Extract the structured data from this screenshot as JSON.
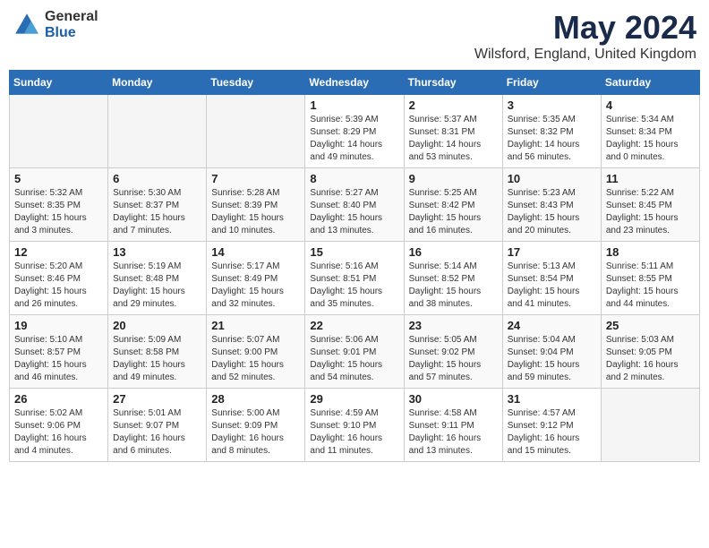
{
  "logo": {
    "general": "General",
    "blue": "Blue"
  },
  "title": {
    "month": "May 2024",
    "location": "Wilsford, England, United Kingdom"
  },
  "weekdays": [
    "Sunday",
    "Monday",
    "Tuesday",
    "Wednesday",
    "Thursday",
    "Friday",
    "Saturday"
  ],
  "weeks": [
    [
      {
        "day": "",
        "info": ""
      },
      {
        "day": "",
        "info": ""
      },
      {
        "day": "",
        "info": ""
      },
      {
        "day": "1",
        "info": "Sunrise: 5:39 AM\nSunset: 8:29 PM\nDaylight: 14 hours and 49 minutes."
      },
      {
        "day": "2",
        "info": "Sunrise: 5:37 AM\nSunset: 8:31 PM\nDaylight: 14 hours and 53 minutes."
      },
      {
        "day": "3",
        "info": "Sunrise: 5:35 AM\nSunset: 8:32 PM\nDaylight: 14 hours and 56 minutes."
      },
      {
        "day": "4",
        "info": "Sunrise: 5:34 AM\nSunset: 8:34 PM\nDaylight: 15 hours and 0 minutes."
      }
    ],
    [
      {
        "day": "5",
        "info": "Sunrise: 5:32 AM\nSunset: 8:35 PM\nDaylight: 15 hours and 3 minutes."
      },
      {
        "day": "6",
        "info": "Sunrise: 5:30 AM\nSunset: 8:37 PM\nDaylight: 15 hours and 7 minutes."
      },
      {
        "day": "7",
        "info": "Sunrise: 5:28 AM\nSunset: 8:39 PM\nDaylight: 15 hours and 10 minutes."
      },
      {
        "day": "8",
        "info": "Sunrise: 5:27 AM\nSunset: 8:40 PM\nDaylight: 15 hours and 13 minutes."
      },
      {
        "day": "9",
        "info": "Sunrise: 5:25 AM\nSunset: 8:42 PM\nDaylight: 15 hours and 16 minutes."
      },
      {
        "day": "10",
        "info": "Sunrise: 5:23 AM\nSunset: 8:43 PM\nDaylight: 15 hours and 20 minutes."
      },
      {
        "day": "11",
        "info": "Sunrise: 5:22 AM\nSunset: 8:45 PM\nDaylight: 15 hours and 23 minutes."
      }
    ],
    [
      {
        "day": "12",
        "info": "Sunrise: 5:20 AM\nSunset: 8:46 PM\nDaylight: 15 hours and 26 minutes."
      },
      {
        "day": "13",
        "info": "Sunrise: 5:19 AM\nSunset: 8:48 PM\nDaylight: 15 hours and 29 minutes."
      },
      {
        "day": "14",
        "info": "Sunrise: 5:17 AM\nSunset: 8:49 PM\nDaylight: 15 hours and 32 minutes."
      },
      {
        "day": "15",
        "info": "Sunrise: 5:16 AM\nSunset: 8:51 PM\nDaylight: 15 hours and 35 minutes."
      },
      {
        "day": "16",
        "info": "Sunrise: 5:14 AM\nSunset: 8:52 PM\nDaylight: 15 hours and 38 minutes."
      },
      {
        "day": "17",
        "info": "Sunrise: 5:13 AM\nSunset: 8:54 PM\nDaylight: 15 hours and 41 minutes."
      },
      {
        "day": "18",
        "info": "Sunrise: 5:11 AM\nSunset: 8:55 PM\nDaylight: 15 hours and 44 minutes."
      }
    ],
    [
      {
        "day": "19",
        "info": "Sunrise: 5:10 AM\nSunset: 8:57 PM\nDaylight: 15 hours and 46 minutes."
      },
      {
        "day": "20",
        "info": "Sunrise: 5:09 AM\nSunset: 8:58 PM\nDaylight: 15 hours and 49 minutes."
      },
      {
        "day": "21",
        "info": "Sunrise: 5:07 AM\nSunset: 9:00 PM\nDaylight: 15 hours and 52 minutes."
      },
      {
        "day": "22",
        "info": "Sunrise: 5:06 AM\nSunset: 9:01 PM\nDaylight: 15 hours and 54 minutes."
      },
      {
        "day": "23",
        "info": "Sunrise: 5:05 AM\nSunset: 9:02 PM\nDaylight: 15 hours and 57 minutes."
      },
      {
        "day": "24",
        "info": "Sunrise: 5:04 AM\nSunset: 9:04 PM\nDaylight: 15 hours and 59 minutes."
      },
      {
        "day": "25",
        "info": "Sunrise: 5:03 AM\nSunset: 9:05 PM\nDaylight: 16 hours and 2 minutes."
      }
    ],
    [
      {
        "day": "26",
        "info": "Sunrise: 5:02 AM\nSunset: 9:06 PM\nDaylight: 16 hours and 4 minutes."
      },
      {
        "day": "27",
        "info": "Sunrise: 5:01 AM\nSunset: 9:07 PM\nDaylight: 16 hours and 6 minutes."
      },
      {
        "day": "28",
        "info": "Sunrise: 5:00 AM\nSunset: 9:09 PM\nDaylight: 16 hours and 8 minutes."
      },
      {
        "day": "29",
        "info": "Sunrise: 4:59 AM\nSunset: 9:10 PM\nDaylight: 16 hours and 11 minutes."
      },
      {
        "day": "30",
        "info": "Sunrise: 4:58 AM\nSunset: 9:11 PM\nDaylight: 16 hours and 13 minutes."
      },
      {
        "day": "31",
        "info": "Sunrise: 4:57 AM\nSunset: 9:12 PM\nDaylight: 16 hours and 15 minutes."
      },
      {
        "day": "",
        "info": ""
      }
    ]
  ]
}
